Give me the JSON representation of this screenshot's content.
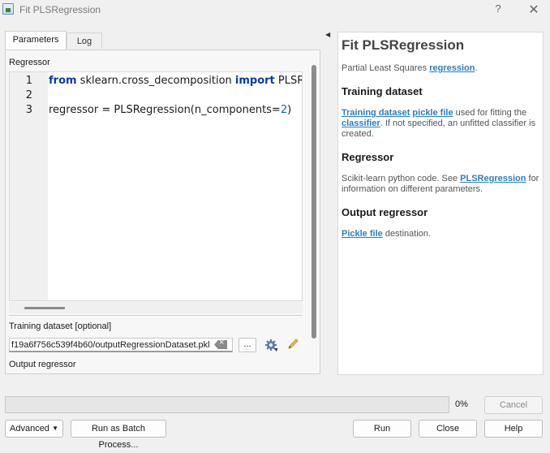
{
  "window": {
    "title": "Fit PLSRegression",
    "help": "?",
    "close": "✕"
  },
  "tabs": [
    {
      "label": "Parameters"
    },
    {
      "label": "Log"
    }
  ],
  "params": {
    "regressor_label": "Regressor",
    "code": {
      "line_numbers": [
        "1",
        "2",
        "3"
      ],
      "line1": {
        "kw1": "from",
        "mod": " sklearn.cross_decomposition ",
        "kw2": "import",
        "rest": " PLSR"
      },
      "line3": {
        "text": "regressor = PLSRegression(n_components=",
        "num": "2",
        "end": ")"
      }
    },
    "training_label": "Training dataset [optional]",
    "training_value": "f19a6f756c539f4b60/outputRegressionDataset.pkl",
    "browse_label": "...",
    "output_label": "Output regressor"
  },
  "help": {
    "title": "Fit PLSRegression",
    "intro": {
      "text": "Partial Least Squares ",
      "link": "regression",
      "end": "."
    },
    "training_heading": "Training dataset",
    "training_text": {
      "link1": "Training dataset",
      "link2": "pickle file",
      "mid": " used for fitting the ",
      "link3": "classifier",
      "end": ". If not specified, an unfitted classifier is created."
    },
    "regressor_heading": "Regressor",
    "regressor_text": {
      "start": "Scikit-learn python code. See ",
      "link": "PLSRegression",
      "end": " for information on different parameters."
    },
    "output_heading": "Output regressor",
    "output_text": {
      "link": "Pickle file",
      "end": " destination."
    }
  },
  "footer": {
    "progress_percent": "0%",
    "progress_value": 0,
    "cancel": "Cancel",
    "advanced": "Advanced",
    "batch": "Run as Batch Process...",
    "run": "Run",
    "close": "Close",
    "help": "Help"
  },
  "colors": {
    "link": "#2a7fc0",
    "keyword": "#0b3aa6",
    "number": "#007a7a"
  },
  "icons": [
    "app-icon",
    "clear-icon",
    "gear-icon",
    "pencil-icon",
    "collapse-arrow-icon",
    "dropdown-arrow-icon"
  ]
}
